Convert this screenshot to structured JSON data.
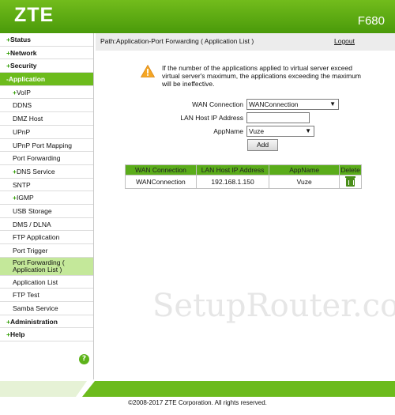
{
  "header": {
    "brand": "ZTE",
    "model": "F680"
  },
  "sidebar": {
    "items": [
      {
        "label": "Status",
        "level": "top"
      },
      {
        "label": "Network",
        "level": "top"
      },
      {
        "label": "Security",
        "level": "top"
      },
      {
        "label": "-Application",
        "level": "top-active"
      },
      {
        "label": "VoIP",
        "level": "sub-plus"
      },
      {
        "label": "DDNS",
        "level": "sub"
      },
      {
        "label": "DMZ Host",
        "level": "sub"
      },
      {
        "label": "UPnP",
        "level": "sub"
      },
      {
        "label": "UPnP Port Mapping",
        "level": "sub"
      },
      {
        "label": "Port Forwarding",
        "level": "sub"
      },
      {
        "label": "DNS Service",
        "level": "sub-plus"
      },
      {
        "label": "SNTP",
        "level": "sub"
      },
      {
        "label": "IGMP",
        "level": "sub-plus"
      },
      {
        "label": "USB Storage",
        "level": "sub"
      },
      {
        "label": "DMS / DLNA",
        "level": "sub"
      },
      {
        "label": "FTP Application",
        "level": "sub"
      },
      {
        "label": "Port Trigger",
        "level": "sub"
      },
      {
        "label": "Port Forwarding ( Application List )",
        "level": "selected"
      },
      {
        "label": "Application List",
        "level": "sub"
      },
      {
        "label": "FTP Test",
        "level": "sub"
      },
      {
        "label": "Samba Service",
        "level": "sub"
      },
      {
        "label": "Administration",
        "level": "top"
      },
      {
        "label": "Help",
        "level": "top"
      }
    ],
    "help_symbol": "?"
  },
  "pathbar": {
    "path": "Path:Application-Port Forwarding ( Application List )",
    "logout": "Logout"
  },
  "warning": {
    "icon": "warning-triangle-icon",
    "text": "If the number of the applications applied to virtual server exceed virtual server's maximum, the applications exceeding the maximum will be ineffective."
  },
  "form": {
    "wan_label": "WAN Connection",
    "wan_value": "WANConnection",
    "lan_label": "LAN Host IP Address",
    "lan_value": "",
    "app_label": "AppName",
    "app_value": "Vuze",
    "add_label": "Add"
  },
  "table": {
    "headers": [
      "WAN Connection",
      "LAN Host IP Address",
      "AppName",
      "Delete"
    ],
    "rows": [
      {
        "wan": "WANConnection",
        "ip": "192.168.1.150",
        "app": "Vuze"
      }
    ]
  },
  "watermark": "SetupRouter.co",
  "footer": "©2008-2017 ZTE Corporation. All rights reserved.",
  "colors": {
    "header_green": "#6cbb1c",
    "table_header": "#5aac1a",
    "selected_bg": "#c4e89a"
  }
}
